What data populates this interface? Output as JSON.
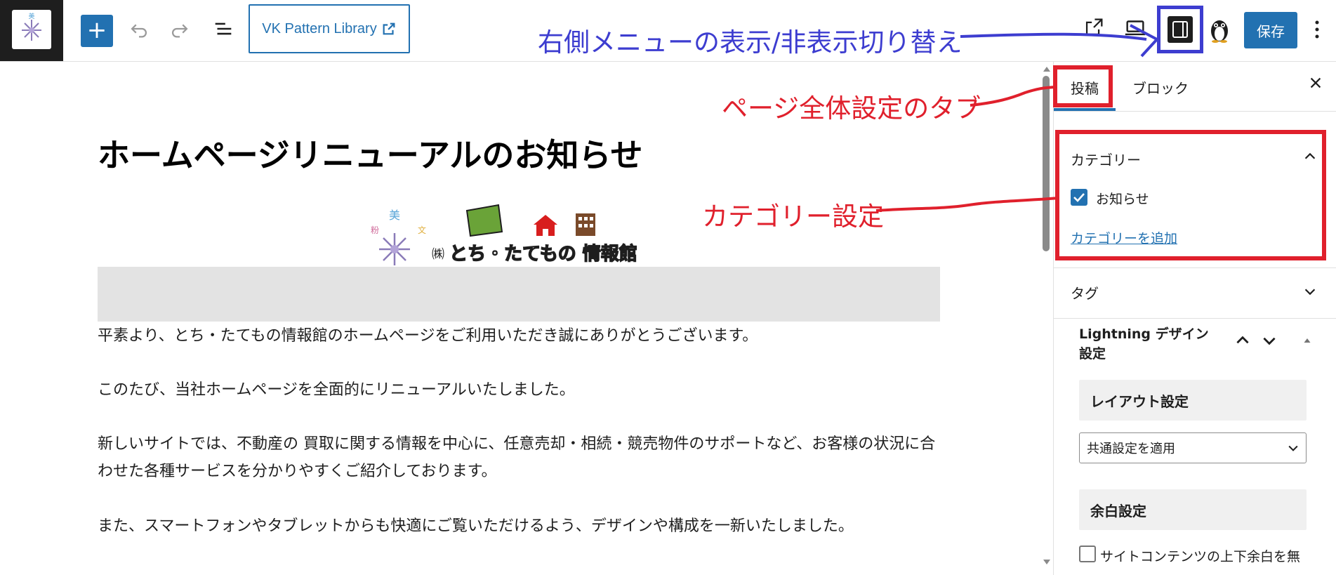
{
  "toolbar": {
    "add_block_icon": "plus-icon",
    "undo_icon": "undo-icon",
    "redo_icon": "redo-icon",
    "list_view_icon": "list-view-icon",
    "vk_button_label": "VK Pattern Library",
    "external_link_icon": "external-link-icon",
    "view_icon": "external-view-icon",
    "preview_icon": "desktop-preview-icon",
    "sidebar_toggle_icon": "sidebar-toggle-icon",
    "plugin_icon": "penguin-icon",
    "save_label": "保存",
    "options_icon": "vertical-ellipsis-icon"
  },
  "annotations": {
    "sidebar_toggle_note": "右側メニューの表示/非表示切り替え",
    "page_settings_tab_note": "ページ全体設定のタブ",
    "category_settings_note": "カテゴリー設定",
    "blue_color": "#3d3dd0",
    "red_color": "#e0202c"
  },
  "editor": {
    "title": "ホームページリニューアルのお知らせ",
    "logo_text": "とち・たてもの 情報館",
    "paragraphs": [
      "平素より、とち・たてもの情報館のホームページをご利用いただき誠にありがとうございます。",
      "このたび、当社ホームページを全面的にリニューアルいたしました。",
      "新しいサイトでは、不動産の 買取に関する情報を中心に、任意売却・相続・競売物件のサポートなど、お客様の状況に合わせた各種サービスを分かりやすくご紹介しております。",
      "また、スマートフォンやタブレットからも快適にご覧いただけるよう、デザインや構成を一新いたしました。"
    ]
  },
  "sidebar": {
    "tabs": [
      "投稿",
      "ブロック"
    ],
    "close_icon": "close-icon",
    "categories": {
      "title": "カテゴリー",
      "items": [
        {
          "label": "お知らせ",
          "checked": true
        }
      ],
      "add_link": "カテゴリーを追加"
    },
    "tags": {
      "title": "タグ"
    },
    "lightning": {
      "title": "Lightning デザイン 設定",
      "layout_heading": "レイアウト設定",
      "layout_select_value": "共通設定を適用",
      "margin_heading": "余白設定",
      "margin_checkbox_label": "サイトコンテンツの上下余白を無",
      "margin_checkbox_checked": false
    }
  },
  "colors": {
    "accent": "#2271b1",
    "dark": "#1e1e1e"
  }
}
